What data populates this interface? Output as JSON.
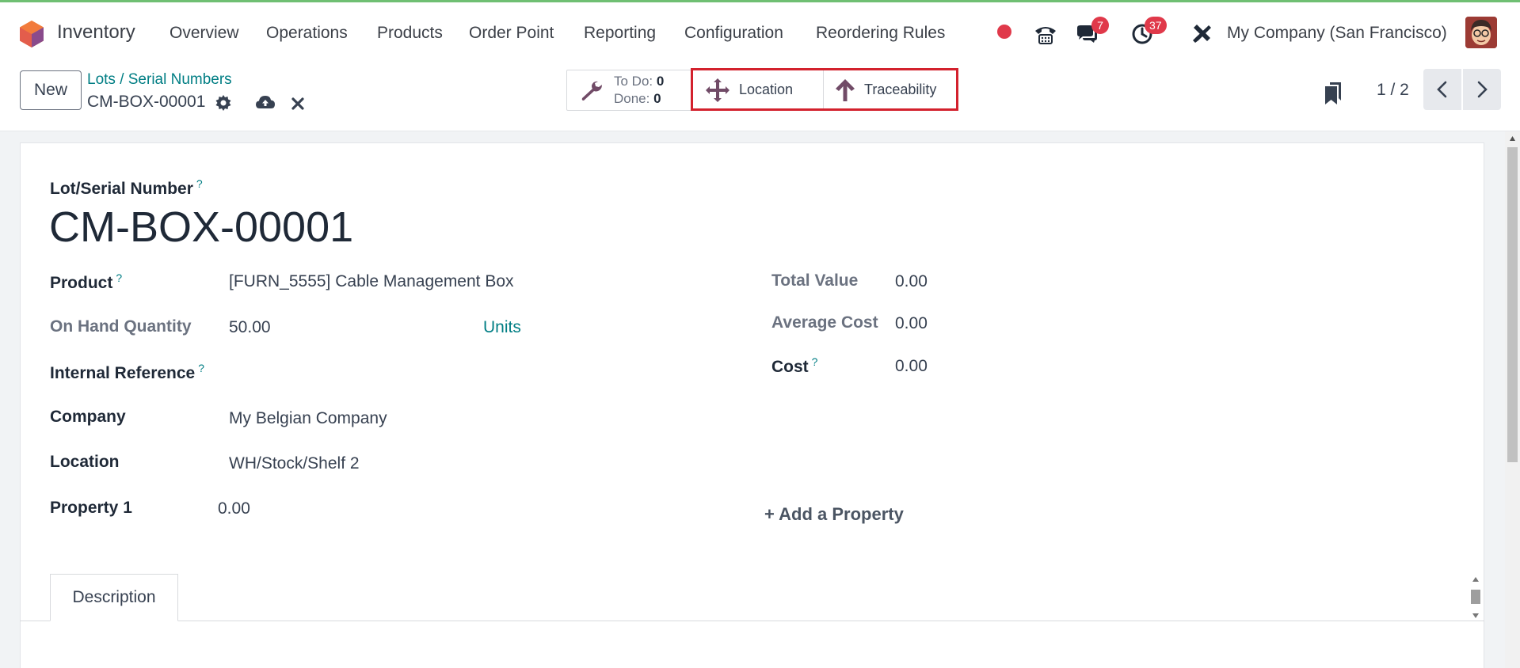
{
  "app": {
    "name": "Inventory"
  },
  "nav": [
    "Overview",
    "Operations",
    "Products",
    "Order Point",
    "Reporting",
    "Configuration",
    "Reordering Rules"
  ],
  "systray": {
    "messages_count": "7",
    "activities_count": "37",
    "company": "My Company (San Francisco)"
  },
  "breadcrumb": {
    "parent": "Lots / Serial Numbers",
    "current": "CM-BOX-00001"
  },
  "new_label": "New",
  "smart_buttons": {
    "todo_label": "To Do:",
    "todo_value": "0",
    "done_label": "Done:",
    "done_value": "0",
    "location": "Location",
    "traceability": "Traceability"
  },
  "pager": {
    "text": "1 / 2"
  },
  "form": {
    "title_label": "Lot/Serial Number",
    "title_help": "?",
    "title_value": "CM-BOX-00001",
    "product_label": "Product",
    "product_value": "[FURN_5555] Cable Management Box",
    "onhand_label": "On Hand Quantity",
    "onhand_value": "50.00",
    "onhand_unit": "Units",
    "internal_ref_label": "Internal Reference",
    "company_label": "Company",
    "company_value": "My Belgian Company",
    "location_label": "Location",
    "location_value": "WH/Stock/Shelf 2",
    "property1_label": "Property 1",
    "property1_value": "0.00",
    "total_value_label": "Total Value",
    "total_value_value": "0.00",
    "avg_cost_label": "Average Cost",
    "avg_cost_value": "0.00",
    "cost_label": "Cost",
    "cost_value": "0.00",
    "add_property": "+ Add a Property",
    "tab_description": "Description"
  },
  "colors": {
    "accent": "#017e84",
    "brand": "#714b67",
    "badge": "#e0394a",
    "highlight": "#d3212d"
  }
}
